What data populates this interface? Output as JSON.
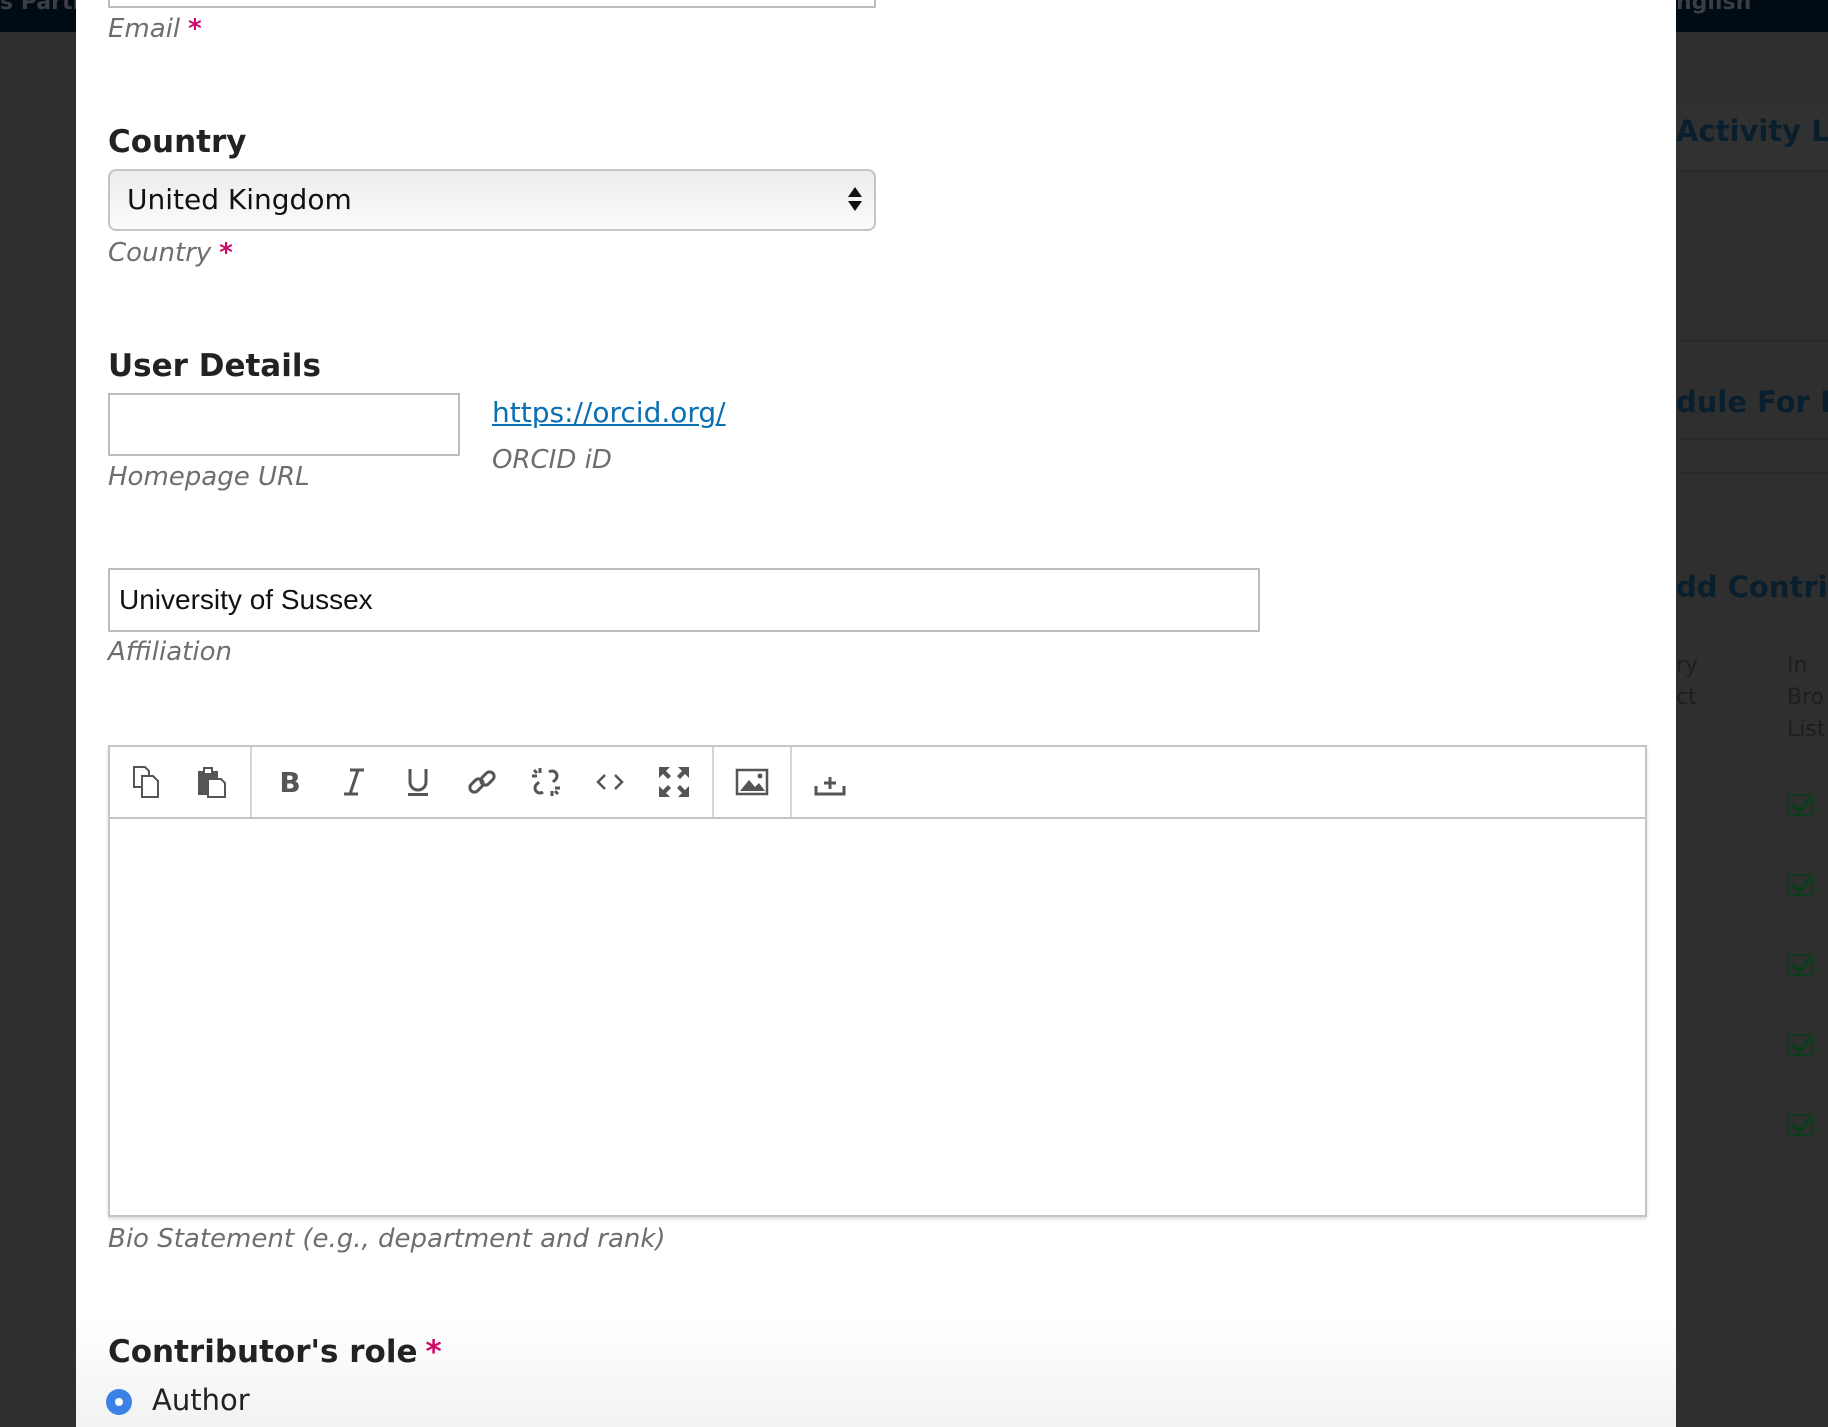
{
  "background": {
    "header_left_text": "s Parti",
    "header_right_text": "nglish",
    "headings": [
      "Activity Log",
      "dule For Pul",
      "dd Contribu"
    ],
    "column_headers": [
      [
        "ry",
        "ct"
      ],
      [
        "In",
        "Bro",
        "List"
      ]
    ],
    "row_checks": 5
  },
  "form": {
    "email": {
      "value": "",
      "label": "Email",
      "required": "*"
    },
    "country": {
      "heading": "Country",
      "selected": "United Kingdom",
      "label": "Country",
      "required": "*"
    },
    "user_details": {
      "heading": "User Details",
      "homepage": {
        "value": "",
        "label": "Homepage URL"
      },
      "orcid": {
        "link": "https://orcid.org/",
        "label": "ORCID iD"
      }
    },
    "affiliation": {
      "value": "University of Sussex",
      "label": "Affiliation"
    },
    "bio": {
      "label": "Bio Statement (e.g., department and rank)",
      "value": "",
      "toolbar": [
        [
          "copy-icon",
          "paste-icon"
        ],
        [
          "bold-icon",
          "italic-icon",
          "underline-icon",
          "link-icon",
          "unlink-icon",
          "code-icon",
          "fullscreen-icon"
        ],
        [
          "image-icon"
        ],
        [
          "upload-icon"
        ]
      ]
    },
    "role": {
      "heading": "Contributor's role",
      "required": "*",
      "options": [
        {
          "label": "Author",
          "selected": true
        }
      ]
    }
  },
  "colors": {
    "required": "#d00a6c",
    "link": "#0a6fb3",
    "radio": "#3b82e6"
  }
}
